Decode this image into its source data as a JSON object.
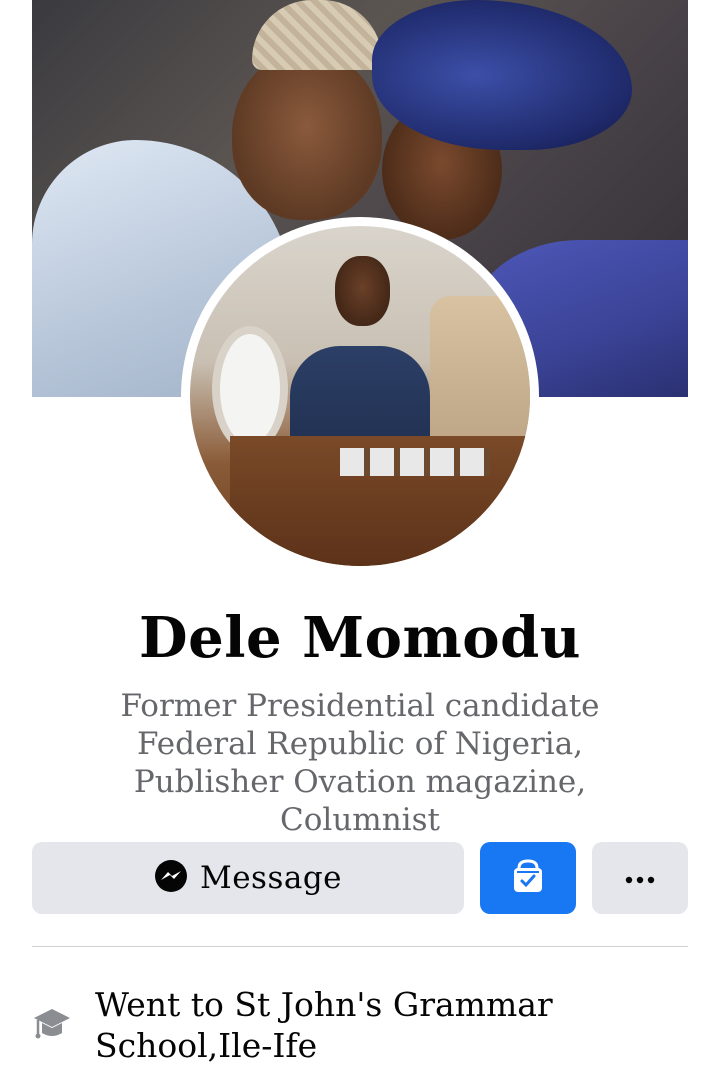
{
  "profile": {
    "name": "Dele Momodu",
    "bio": "Former Presidential candidate Federal Republic of Nigeria, Publisher Ovation magazine, Columnist"
  },
  "actions": {
    "message_label": "Message",
    "message_icon": "messenger-icon",
    "secondary_icon": "friends-check-icon",
    "more_icon": "more-dots-icon",
    "accent": "#1877f2"
  },
  "intro": {
    "education": "Went to St John's Grammar School,Ile-Ife",
    "education_icon": "graduation-cap-icon"
  }
}
